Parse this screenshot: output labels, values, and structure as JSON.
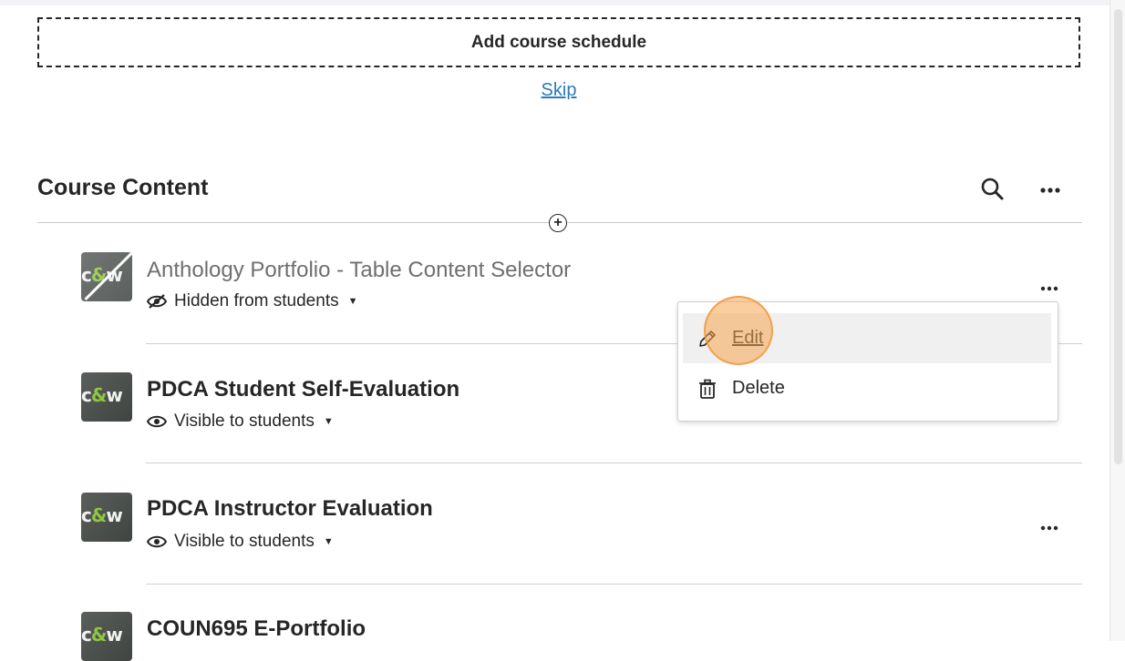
{
  "schedule": {
    "add_label": "Add course schedule",
    "skip_label": "Skip"
  },
  "section": {
    "title": "Course Content"
  },
  "icons": {
    "search": "search-icon",
    "more": "more-icon",
    "add": "add-circle-icon",
    "hidden": "eye-slash-icon",
    "visible": "eye-icon",
    "edit": "pencil-icon",
    "delete": "trash-icon"
  },
  "items": [
    {
      "logo": "c&w",
      "title": "Anthology Portfolio - Table Content Selector",
      "status": "Hidden from students",
      "hidden": true
    },
    {
      "logo": "c&w",
      "title": "PDCA Student Self-Evaluation",
      "status": "Visible to students",
      "hidden": false
    },
    {
      "logo": "c&w",
      "title": "PDCA Instructor Evaluation",
      "status": "Visible to students",
      "hidden": false
    },
    {
      "logo": "c&w",
      "title": "COUN695 E-Portfolio",
      "status": "",
      "hidden": false
    }
  ],
  "menu": {
    "items": [
      {
        "label": "Edit",
        "selected": true
      },
      {
        "label": "Delete",
        "selected": false
      }
    ]
  },
  "colors": {
    "link": "#2b7bb9",
    "text": "#262626",
    "highlight": "#f5a650",
    "logo_accent": "#8fc63f"
  }
}
